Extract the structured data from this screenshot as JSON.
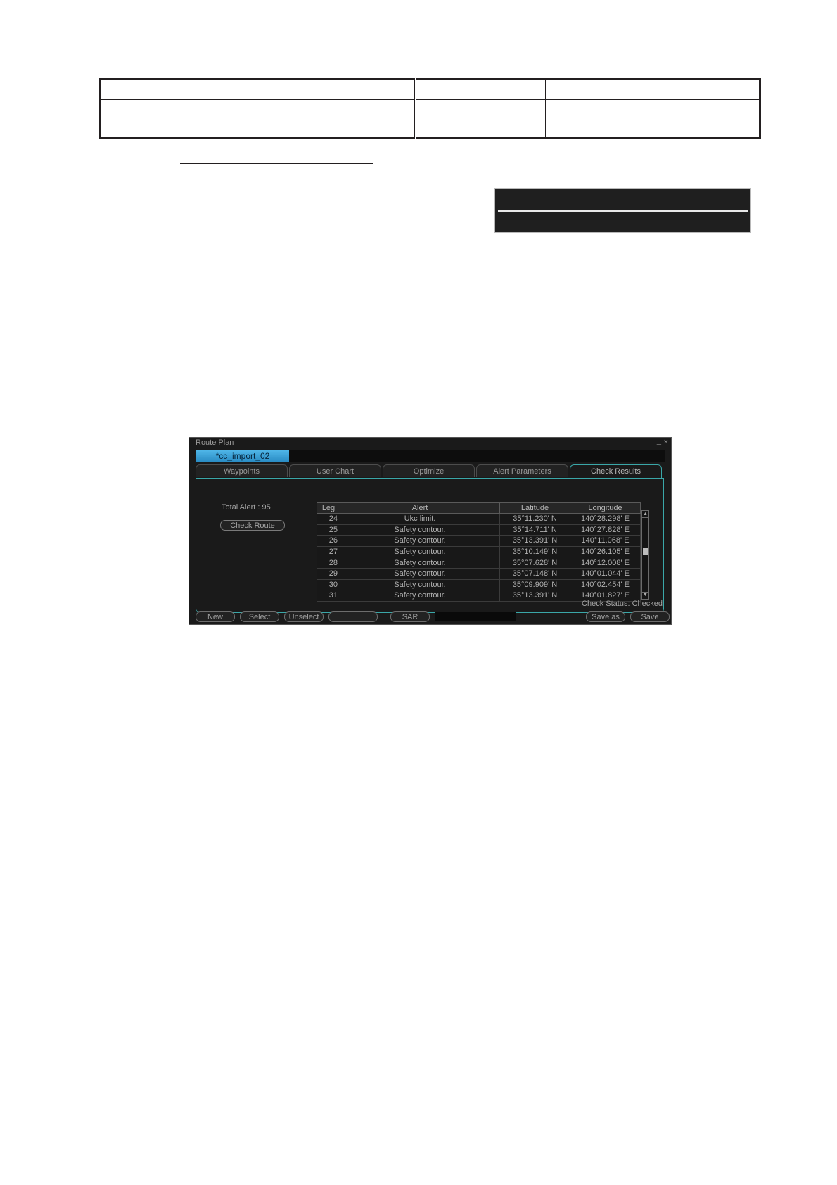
{
  "window": {
    "title": "Route Plan",
    "minimize_glyph": "_",
    "close_glyph": "×"
  },
  "route": {
    "name": "*cc_import_02"
  },
  "tabs": [
    {
      "label": "Waypoints",
      "active": false
    },
    {
      "label": "User Chart",
      "active": false
    },
    {
      "label": "Optimize",
      "active": false
    },
    {
      "label": "Alert Parameters",
      "active": false
    },
    {
      "label": "Check Results",
      "active": true
    }
  ],
  "check_results": {
    "total_alert_label": "Total Alert :  95",
    "check_route_label": "Check Route",
    "columns": [
      "Leg",
      "Alert",
      "Latitude",
      "Longitude"
    ],
    "rows": [
      {
        "leg": "24",
        "alert": "Ukc limit.",
        "latitude": "35°11.230' N",
        "longitude": "140°28.298' E"
      },
      {
        "leg": "25",
        "alert": "Safety contour.",
        "latitude": "35°14.711' N",
        "longitude": "140°27.828' E"
      },
      {
        "leg": "26",
        "alert": "Safety contour.",
        "latitude": "35°13.391' N",
        "longitude": "140°11.068' E"
      },
      {
        "leg": "27",
        "alert": "Safety contour.",
        "latitude": "35°10.149' N",
        "longitude": "140°26.105' E"
      },
      {
        "leg": "28",
        "alert": "Safety contour.",
        "latitude": "35°07.628' N",
        "longitude": "140°12.008' E"
      },
      {
        "leg": "29",
        "alert": "Safety contour.",
        "latitude": "35°07.148' N",
        "longitude": "140°01.044' E"
      },
      {
        "leg": "30",
        "alert": "Safety contour.",
        "latitude": "35°09.909' N",
        "longitude": "140°02.454' E"
      },
      {
        "leg": "31",
        "alert": "Safety contour.",
        "latitude": "35°13.391' N",
        "longitude": "140°01.827' E"
      }
    ],
    "check_status_label": "Check Status:  Checked"
  },
  "bottom_buttons": {
    "new": "New",
    "select": "Select",
    "unselect": "Unselect",
    "blank": "",
    "sar": "SAR",
    "save_as": "Save as",
    "save": "Save"
  },
  "colors": {
    "window_bg": "#1a1a1a",
    "accent_teal": "#3aa7a8",
    "route_highlight": "#2a8cc4"
  }
}
